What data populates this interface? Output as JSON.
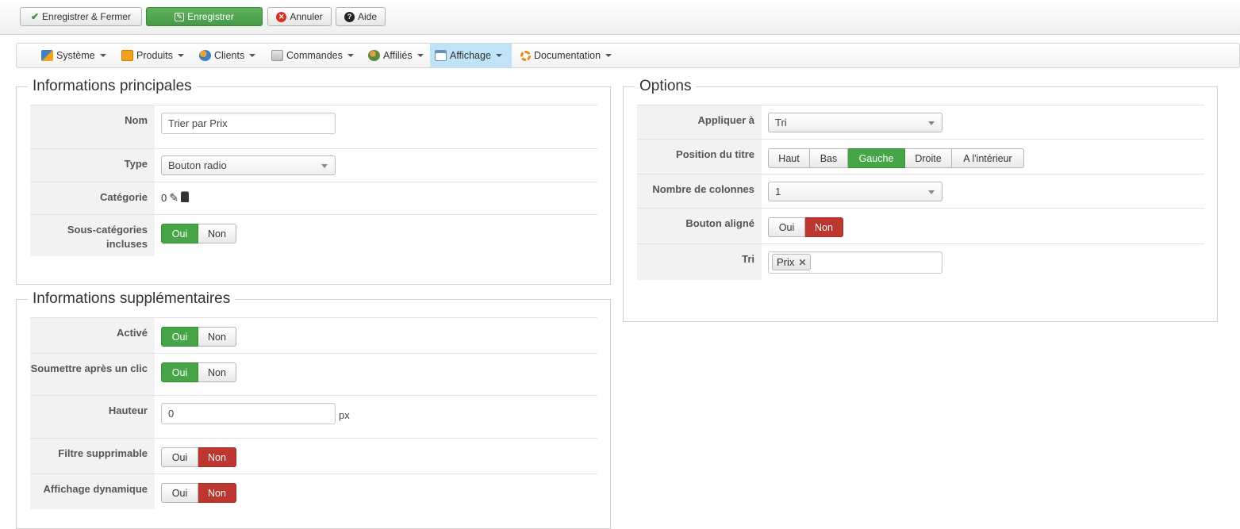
{
  "toolbar": {
    "save_close_label": "Enregistrer & Fermer",
    "save_label": "Enregistrer",
    "cancel_label": "Annuler",
    "help_label": "Aide"
  },
  "menu": {
    "items": [
      {
        "label": "Système",
        "icon": "tools-icon"
      },
      {
        "label": "Produits",
        "icon": "box-icon"
      },
      {
        "label": "Clients",
        "icon": "users-icon"
      },
      {
        "label": "Commandes",
        "icon": "orders-icon"
      },
      {
        "label": "Affiliés",
        "icon": "affiliates-icon"
      },
      {
        "label": "Affichage",
        "icon": "display-icon",
        "active": true
      },
      {
        "label": "Documentation",
        "icon": "lifebuoy-icon"
      }
    ]
  },
  "main_info": {
    "legend": "Informations principales",
    "name_label": "Nom",
    "name_value": "Trier par Prix",
    "type_label": "Type",
    "type_value": "Bouton radio",
    "category_label": "Catégorie",
    "category_value": "0",
    "subcat_label": "Sous-catégories incluses",
    "subcat_yes": "Oui",
    "subcat_no": "Non"
  },
  "extra_info": {
    "legend": "Informations supplémentaires",
    "enabled_label": "Activé",
    "submit_label": "Soumettre après un clic",
    "height_label": "Hauteur",
    "height_value": "0",
    "height_unit": "px",
    "deletable_label": "Filtre supprimable",
    "dynamic_label": "Affichage dynamique",
    "yes": "Oui",
    "no": "Non"
  },
  "options": {
    "legend": "Options",
    "apply_label": "Appliquer à",
    "apply_value": "Tri",
    "title_pos_label": "Position du titre",
    "title_pos_options": [
      "Haut",
      "Bas",
      "Gauche",
      "Droite",
      "A l'intérieur"
    ],
    "title_pos_selected": "Gauche",
    "columns_label": "Nombre de colonnes",
    "columns_value": "1",
    "aligned_label": "Bouton aligné",
    "yes": "Oui",
    "no": "Non",
    "sort_label": "Tri",
    "sort_tag": "Prix"
  },
  "colors": {
    "green": "#46a546",
    "red": "#bd362f",
    "active_menu": "#bfe3f7"
  }
}
